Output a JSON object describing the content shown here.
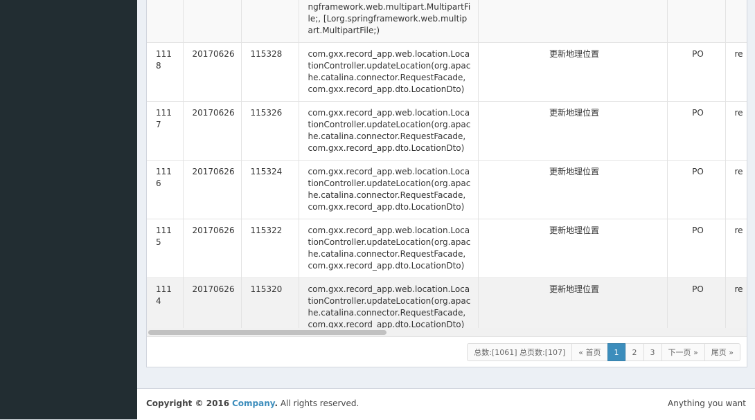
{
  "colors": {
    "sidebar": "#222d32",
    "accent": "#3c8dbc",
    "content_bg": "#ecf0f5"
  },
  "table": {
    "rows": [
      {
        "id": "",
        "date": "",
        "seq": "",
        "method": "gxx.record_app.dto.DailyDto, [Lorg.springframework.web.multipart.MultipartFile;, [Lorg.springframework.web.multipart.MultipartFile;)",
        "desc": "",
        "type": "",
        "extra": ""
      },
      {
        "id": "1118",
        "date": "20170626",
        "seq": "115328",
        "method": "com.gxx.record_app.web.location.LocationController.updateLocation(org.apache.catalina.connector.RequestFacade, com.gxx.record_app.dto.LocationDto)",
        "desc": "更新地理位置",
        "type": "PO",
        "extra": "re"
      },
      {
        "id": "1117",
        "date": "20170626",
        "seq": "115326",
        "method": "com.gxx.record_app.web.location.LocationController.updateLocation(org.apache.catalina.connector.RequestFacade, com.gxx.record_app.dto.LocationDto)",
        "desc": "更新地理位置",
        "type": "PO",
        "extra": "re"
      },
      {
        "id": "1116",
        "date": "20170626",
        "seq": "115324",
        "method": "com.gxx.record_app.web.location.LocationController.updateLocation(org.apache.catalina.connector.RequestFacade, com.gxx.record_app.dto.LocationDto)",
        "desc": "更新地理位置",
        "type": "PO",
        "extra": "re"
      },
      {
        "id": "1115",
        "date": "20170626",
        "seq": "115322",
        "method": "com.gxx.record_app.web.location.LocationController.updateLocation(org.apache.catalina.connector.RequestFacade, com.gxx.record_app.dto.LocationDto)",
        "desc": "更新地理位置",
        "type": "PO",
        "extra": "re"
      },
      {
        "id": "1114",
        "date": "20170626",
        "seq": "115320",
        "method": "com.gxx.record_app.web.location.LocationController.updateLocation(org.apache.catalina.connector.RequestFacade, com.gxx.record_app.dto.LocationDto)",
        "desc": "更新地理位置",
        "type": "PO",
        "extra": "re"
      }
    ]
  },
  "pagination": {
    "summary": "总数:[1061] 总页数:[107]",
    "first": "« 首页",
    "pages": [
      "1",
      "2",
      "3"
    ],
    "current": "1",
    "next": "下一页 »",
    "last": "尾页 »"
  },
  "footer": {
    "copyright_prefix": "Copyright © 2016",
    "company": "Company",
    "suffix": ". All rights reserved.",
    "right_text": "Anything you want"
  }
}
